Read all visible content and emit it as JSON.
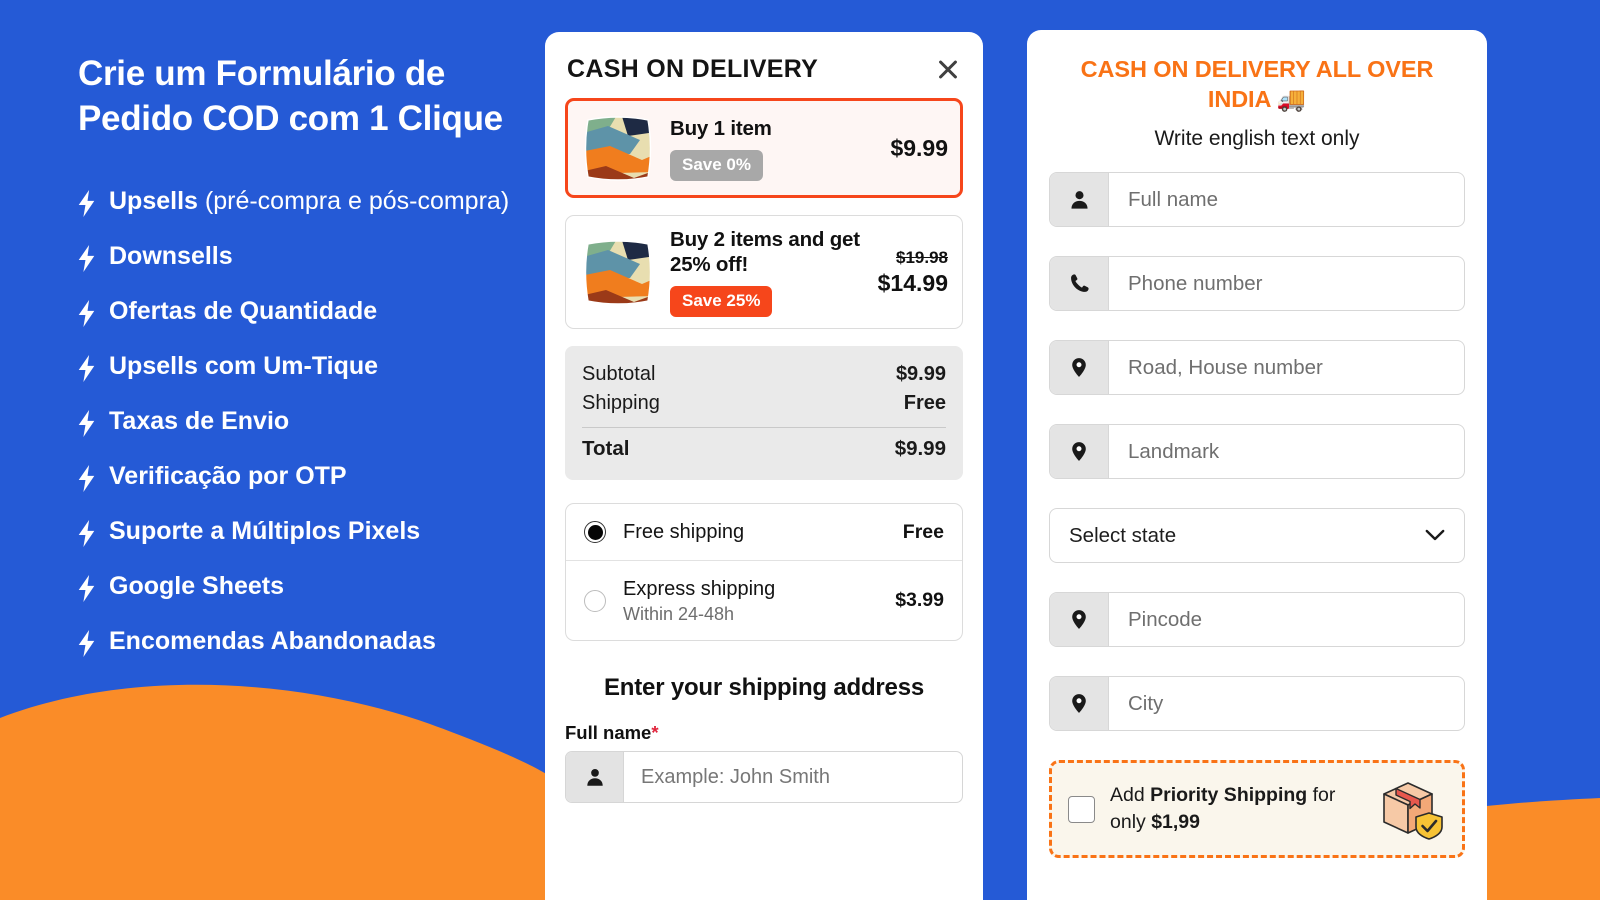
{
  "theme": {
    "blue": "#255AD6",
    "orange": "#FA8C28",
    "accent_orange": "#F97316",
    "red": "#F6461B"
  },
  "promo": {
    "title": "Crie um Formulário de Pedido COD com 1 Clique",
    "features": [
      {
        "bold": "Upsells",
        "rest": " (pré-compra e pós-compra)"
      },
      {
        "bold": "Downsells",
        "rest": ""
      },
      {
        "bold": "Ofertas de Quantidade",
        "rest": ""
      },
      {
        "bold": "Upsells com Um-Tique",
        "rest": ""
      },
      {
        "bold": "Taxas de Envio",
        "rest": ""
      },
      {
        "bold": "Verificação por OTP",
        "rest": ""
      },
      {
        "bold": "Suporte a Múltiplos Pixels",
        "rest": ""
      },
      {
        "bold": "Google Sheets",
        "rest": ""
      },
      {
        "bold": "Encomendas Abandonadas",
        "rest": ""
      }
    ]
  },
  "cart": {
    "title": "CASH ON DELIVERY",
    "close_icon": "close-icon",
    "offers": [
      {
        "name": "Buy 1 item",
        "badge": "Save 0%",
        "badge_style": "grey",
        "price_was": "",
        "price_now": "$9.99",
        "selected": true
      },
      {
        "name": "Buy 2 items and get 25% off!",
        "badge": "Save 25%",
        "badge_style": "red",
        "price_was": "$19.98",
        "price_now": "$14.99",
        "selected": false
      }
    ],
    "totals": {
      "subtotal_label": "Subtotal",
      "subtotal_value": "$9.99",
      "shipping_label": "Shipping",
      "shipping_value": "Free",
      "total_label": "Total",
      "total_value": "$9.99"
    },
    "shipping_methods": [
      {
        "name": "Free shipping",
        "sub": "",
        "price": "Free",
        "selected": true
      },
      {
        "name": "Express shipping",
        "sub": "Within 24-48h",
        "price": "$3.99",
        "selected": false
      }
    ],
    "address_heading": "Enter your shipping address",
    "fullname_label": "Full name",
    "required_mark": "*",
    "fullname_placeholder": "Example: John Smith",
    "fullname_icon": "person-icon"
  },
  "form": {
    "title": "CASH ON DELIVERY ALL OVER INDIA 🚚",
    "subtitle": "Write english text only",
    "fields": [
      {
        "placeholder": "Full name",
        "icon": "person-icon",
        "type": "text"
      },
      {
        "placeholder": "Phone number",
        "icon": "phone-icon",
        "type": "text"
      },
      {
        "placeholder": "Road, House number",
        "icon": "location-icon",
        "type": "text"
      },
      {
        "placeholder": "Landmark",
        "icon": "location-icon",
        "type": "text"
      },
      {
        "placeholder": "Select state",
        "icon": "chevron-down-icon",
        "type": "select"
      },
      {
        "placeholder": "Pincode",
        "icon": "location-icon",
        "type": "text"
      },
      {
        "placeholder": "City",
        "icon": "location-icon",
        "type": "text"
      }
    ],
    "priority": {
      "text_pre": "Add ",
      "text_bold": "Priority Shipping",
      "text_mid": " for only ",
      "price": "$1,99",
      "icon": "package-shield-icon",
      "checked": false
    }
  }
}
